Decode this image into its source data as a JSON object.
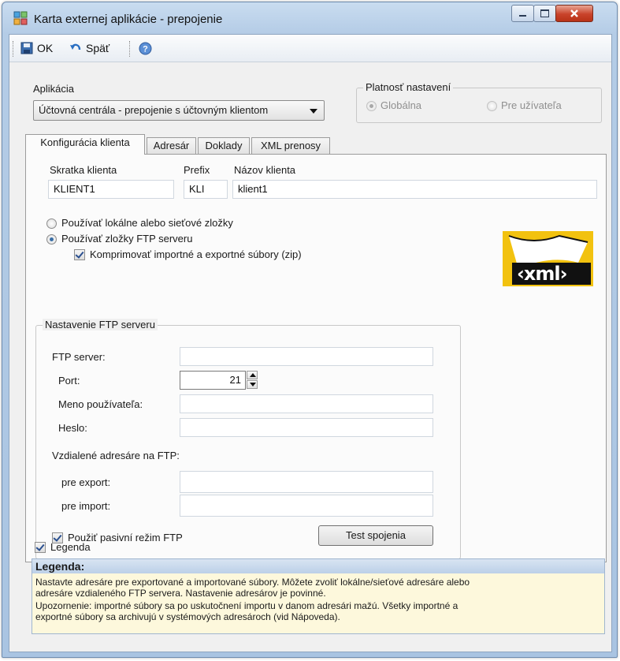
{
  "window": {
    "title": "Karta externej aplikácie - prepojenie"
  },
  "toolbar": {
    "ok_label": "OK",
    "back_label": "Späť"
  },
  "app": {
    "label": "Aplikácia",
    "selected": "Účtovná centrála - prepojenie s účtovným klientom"
  },
  "validity": {
    "title": "Platnosť nastavení",
    "global_label": "Globálna",
    "user_label": "Pre užívateľa"
  },
  "tabs": [
    {
      "label": "Konfigurácia klienta"
    },
    {
      "label": "Adresár"
    },
    {
      "label": "Doklady"
    },
    {
      "label": "XML prenosy"
    }
  ],
  "client": {
    "shortcut_label": "Skratka klienta",
    "shortcut_value": "KLIENT1",
    "prefix_label": "Prefix",
    "prefix_value": "KLI",
    "name_label": "Názov klienta",
    "name_value": "klient1"
  },
  "folders": {
    "local_label": "Používať lokálne alebo sieťové zložky",
    "ftp_label": "Používať zložky FTP serveru",
    "compress_label": "Komprimovať importné a exportné súbory (zip)"
  },
  "logo": {
    "text": "‹xml›"
  },
  "ftp": {
    "title": "Nastavenie FTP serveru",
    "server_label": "FTP server:",
    "server_value": "",
    "port_label": "Port:",
    "port_value": "21",
    "user_label": "Meno používateľa:",
    "user_value": "",
    "password_label": "Heslo:",
    "password_value": "",
    "remote_label": "Vzdialené adresáre na FTP:",
    "export_label": "pre export:",
    "export_value": "",
    "import_label": "pre import:",
    "import_value": "",
    "passive_label": "Použiť pasivní režim FTP",
    "test_label": "Test spojenia"
  },
  "legend": {
    "checkbox_label": "Legenda",
    "heading": "Legenda:",
    "line1": "Nastavte adresáre pre exportované a importované súbory. Môžete zvoliť lokálne/sieťové adresáre alebo",
    "line2": "adresáre vzdialeného FTP servera. Nastavenie adresárov je povinné.",
    "line3": "Upozornenie: importné súbory sa po uskutočnení importu v danom adresári mažú. Všetky importné a",
    "line4": "exportné súbory sa archivujú v systémových adresároch (vid Nápoveda)."
  }
}
